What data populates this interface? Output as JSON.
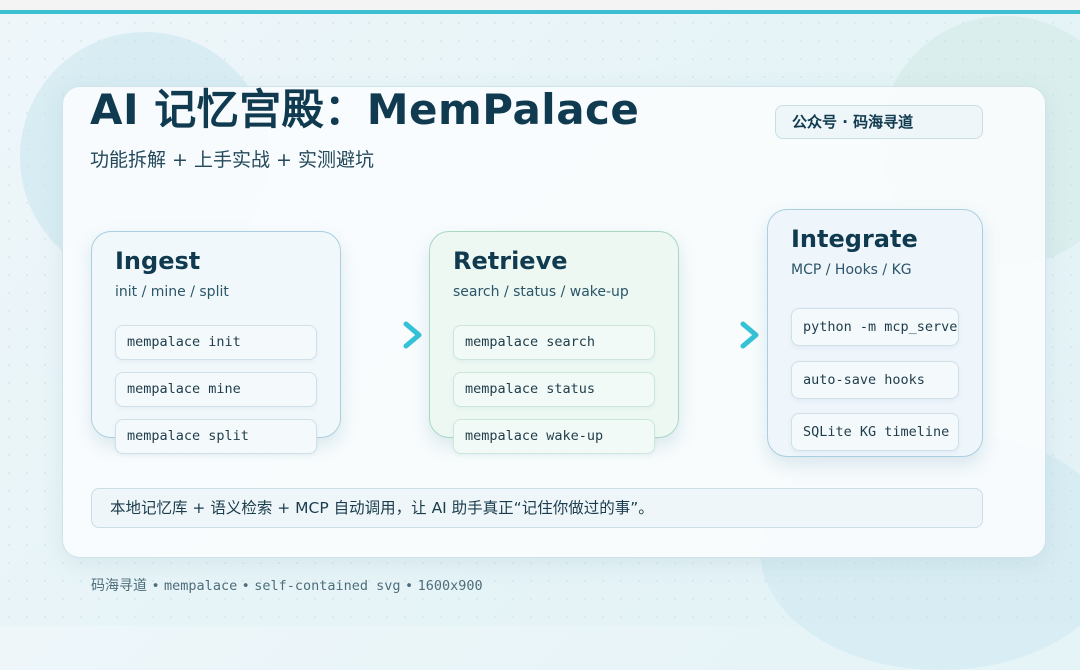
{
  "header": {
    "title": "AI 记忆宫殿：MemPalace",
    "subtitle": "功能拆解 + 上手实战 + 实测避坑",
    "badge": "公众号 · 码海寻道"
  },
  "stages": [
    {
      "title": "Ingest",
      "subtitle": "init / mine / split",
      "commands": [
        "mempalace init",
        "mempalace mine",
        "mempalace split"
      ]
    },
    {
      "title": "Retrieve",
      "subtitle": "search / status / wake-up",
      "commands": [
        "mempalace search",
        "mempalace status",
        "mempalace wake-up"
      ]
    },
    {
      "title": "Integrate",
      "subtitle": "MCP / Hooks / KG",
      "commands": [
        "python -m mcp_server",
        "auto-save hooks",
        "SQLite KG timeline"
      ]
    }
  ],
  "arrows": [
    "chevron-right-icon",
    "chevron-right-icon"
  ],
  "note": "本地记忆库 + 语义检索 + MCP 自动调用，让 AI 助手真正“记住你做过的事”。",
  "footer": {
    "author": "码海寻道",
    "separator": "•",
    "project": "mempalace",
    "format": "self-contained svg",
    "size": "1600x900"
  },
  "colors": {
    "accent": "#3bbfd1",
    "title": "#103a4f",
    "arrow": "#35c2d6"
  }
}
